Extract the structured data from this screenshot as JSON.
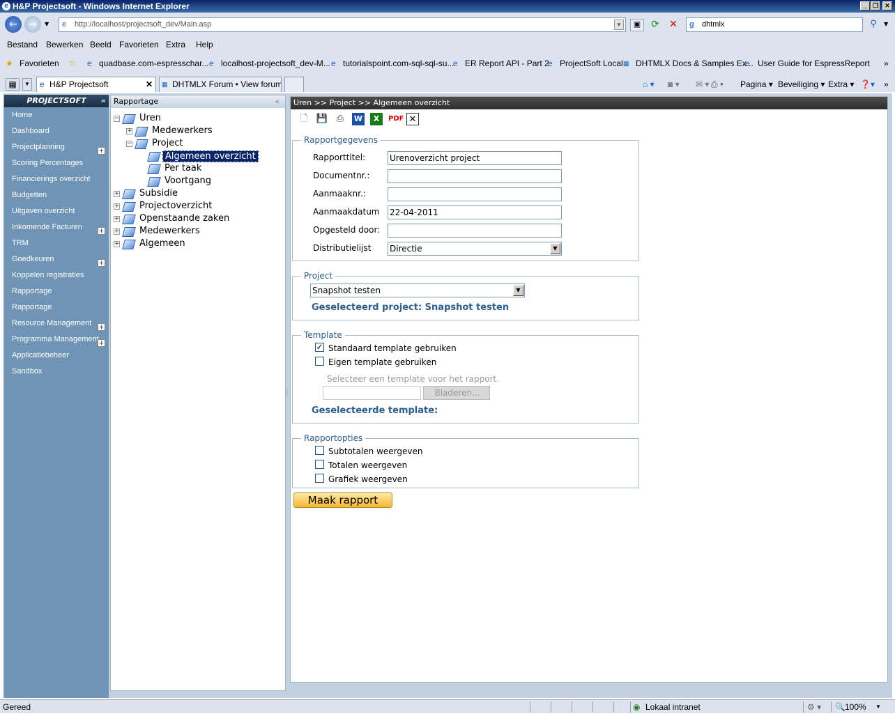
{
  "window": {
    "title": "H&P Projectsoft - Windows Internet Explorer"
  },
  "browser": {
    "address": "http://localhost/projectsoft_dev/Main.asp",
    "search": "dhtmlx",
    "menu": [
      "Bestand",
      "Bewerken",
      "Beeld",
      "Favorieten",
      "Extra",
      "Help"
    ],
    "favorites_label": "Favorieten",
    "favorites": [
      "quadbase.com-espresschar...",
      "localhost-projectsoft_dev-M...",
      "tutorialspoint.com-sql-sql-su...",
      "ER Report API - Part 2",
      "ProjectSoft Local",
      "DHTMLX Docs & Samples Ex...",
      "User Guide for EspressReport"
    ],
    "tabs": [
      "H&P Projectsoft",
      "DHTMLX Forum • View forum..."
    ],
    "toolbar_right": [
      "Pagina",
      "Beveiliging",
      "Extra"
    ]
  },
  "sidebar": {
    "title": "PROJECTSOFT",
    "items": [
      {
        "label": "Home",
        "expandable": false
      },
      {
        "label": "Dashboard",
        "expandable": false
      },
      {
        "label": "Projectplanning",
        "expandable": true
      },
      {
        "label": "Scoring Percentages",
        "expandable": false
      },
      {
        "label": "Financierings overzicht",
        "expandable": false
      },
      {
        "label": "Budgetten",
        "expandable": false
      },
      {
        "label": "Uitgaven overzicht",
        "expandable": false
      },
      {
        "label": "Inkomende Facturen",
        "expandable": true
      },
      {
        "label": "TRM",
        "expandable": false
      },
      {
        "label": "Goedkeuren",
        "expandable": true
      },
      {
        "label": "Koppelen registraties",
        "expandable": false
      },
      {
        "label": "Rapportage",
        "expandable": false
      },
      {
        "label": "Rapportage",
        "expandable": false
      },
      {
        "label": "Resource Management",
        "expandable": true
      },
      {
        "label": "Programma Management",
        "expandable": true
      },
      {
        "label": "Applicatiebeheer",
        "expandable": false
      },
      {
        "label": "Sandbox",
        "expandable": false
      }
    ]
  },
  "tree": {
    "title": "Rapportage",
    "nodes": {
      "uren": "Uren",
      "medewerkers1": "Medewerkers",
      "project": "Project",
      "algemeen_overzicht": "Algemeen overzicht",
      "per_taak": "Per taak",
      "voortgang": "Voortgang",
      "subsidie": "Subsidie",
      "projectoverzicht": "Projectoverzicht",
      "openstaande": "Openstaande zaken",
      "medewerkers2": "Medewerkers",
      "algemeen": "Algemeen"
    }
  },
  "main": {
    "breadcrumb": "Uren >> Project >> Algemeen overzicht",
    "report": {
      "legend": "Rapportgegevens",
      "title_label": "Rapporttitel:",
      "title_value": "Urenoverzicht project",
      "docnr_label": "Documentnr.:",
      "docnr_value": "",
      "aanmaaknr_label": "Aanmaaknr.:",
      "aanmaaknr_value": "",
      "datum_label": "Aanmaakdatum",
      "datum_value": "22-04-2011",
      "opgesteld_label": "Opgesteld door:",
      "opgesteld_value": "",
      "distributie_label": "Distributielijst",
      "distributie_value": "Directie"
    },
    "project": {
      "legend": "Project",
      "select_value": "Snapshot testen",
      "selected_label": "Geselecteerd project: Snapshot testen"
    },
    "template": {
      "legend": "Template",
      "standard_label": "Standaard template gebruiken",
      "standard_checked": true,
      "own_label": "Eigen template gebruiken",
      "own_checked": false,
      "hint": "Selecteer een template voor het rapport.",
      "browse_label": "Bladeren...",
      "selected_label": "Geselecteerde template:"
    },
    "options": {
      "legend": "Rapportopties",
      "subtotals": "Subtotalen weergeven",
      "totals": "Totalen weergeven",
      "graph": "Grafiek weergeven"
    },
    "make_button": "Maak rapport"
  },
  "status": {
    "left": "Gereed",
    "zone": "Lokaal intranet",
    "zoom": "100%"
  }
}
